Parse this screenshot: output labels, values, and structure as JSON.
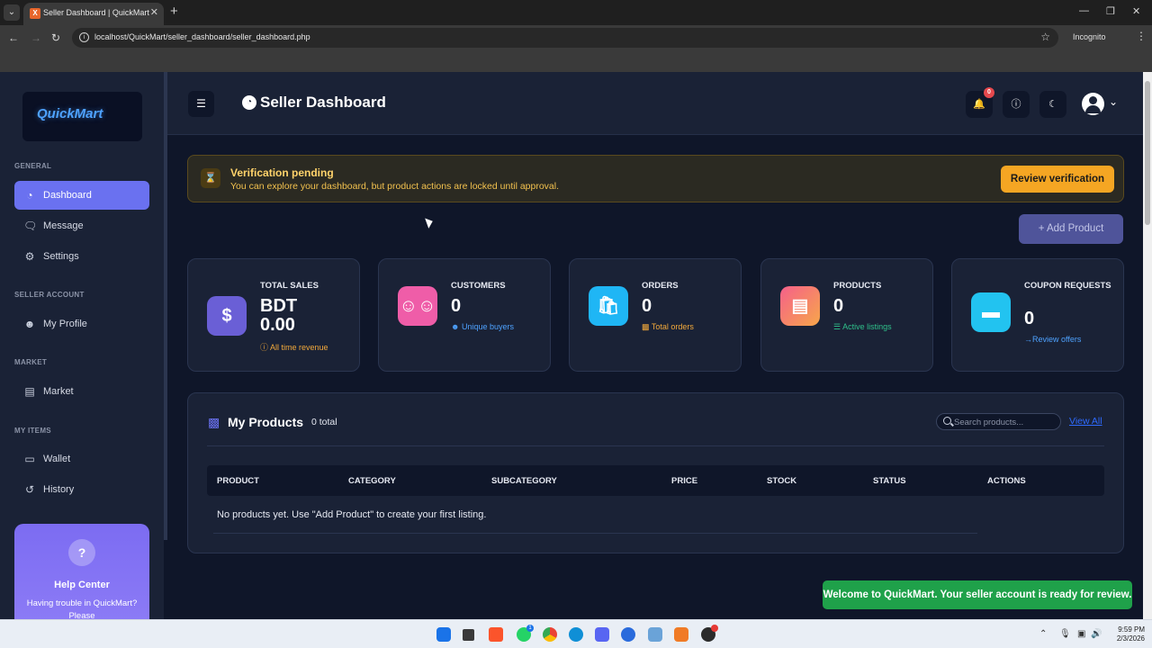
{
  "browser": {
    "tab_title": "Seller Dashboard | QuickMart",
    "url": "localhost/QuickMart/seller_dashboard/seller_dashboard.php",
    "mode_label": "Incognito"
  },
  "sidebar": {
    "logo": "QuickMart",
    "sections": {
      "general": "GENERAL",
      "seller_account": "SELLER ACCOUNT",
      "market": "MARKET",
      "my_items": "MY ITEMS"
    },
    "items": [
      {
        "label": "Dashboard",
        "icon": "dashboard-icon",
        "active": true
      },
      {
        "label": "Message",
        "icon": "message-icon"
      },
      {
        "label": "Settings",
        "icon": "gear-icon"
      },
      {
        "label": "My Profile",
        "icon": "user-icon"
      },
      {
        "label": "Market",
        "icon": "store-icon"
      },
      {
        "label": "Wallet",
        "icon": "wallet-icon"
      },
      {
        "label": "History",
        "icon": "history-icon"
      }
    ],
    "help": {
      "title": "Help Center",
      "text": "Having trouble in QuickMart? Please"
    }
  },
  "header": {
    "title": "Seller Dashboard",
    "notification_count": "0"
  },
  "alert": {
    "title": "Verification pending",
    "text": "You can explore your dashboard, but product actions are locked until approval.",
    "button": "Review verification"
  },
  "actions": {
    "add_product": "+ Add Product"
  },
  "stats": [
    {
      "label": "TOTAL SALES",
      "value": "BDT 0.00",
      "sub": "All time revenue",
      "icon": "dollar-icon",
      "color": "#6a5fd6",
      "sub_color": "#f2a93b"
    },
    {
      "label": "CUSTOMERS",
      "value": "0",
      "sub": "Unique buyers",
      "icon": "users-icon",
      "color": "#ef5da8",
      "sub_color": "#4ea2ff"
    },
    {
      "label": "ORDERS",
      "value": "0",
      "sub": "Total orders",
      "icon": "shopping-bag-icon",
      "color": "#1fb6f5",
      "sub_color": "#f2a93b"
    },
    {
      "label": "PRODUCTS",
      "value": "0",
      "sub": "Active listings",
      "icon": "box-icon",
      "color": "#f5826a",
      "sub_color": "#2fc08a"
    },
    {
      "label": "COUPON REQUESTS",
      "value": "0",
      "sub": "Review offers",
      "icon": "ticket-icon",
      "color": "#22c3f0",
      "sub_color": "#4ea2ff"
    }
  ],
  "products": {
    "title": "My Products",
    "count": "0 total",
    "search_placeholder": "Search products...",
    "view_all": "View All",
    "columns": [
      "PRODUCT",
      "CATEGORY",
      "SUBCATEGORY",
      "PRICE",
      "STOCK",
      "STATUS",
      "ACTIONS"
    ],
    "empty_message": "No products yet. Use \"Add Product\" to create your first listing."
  },
  "toast": "Welcome to QuickMart. Your seller account is ready for review.",
  "system": {
    "time": "9:59 PM",
    "date": "2/3/2026"
  }
}
